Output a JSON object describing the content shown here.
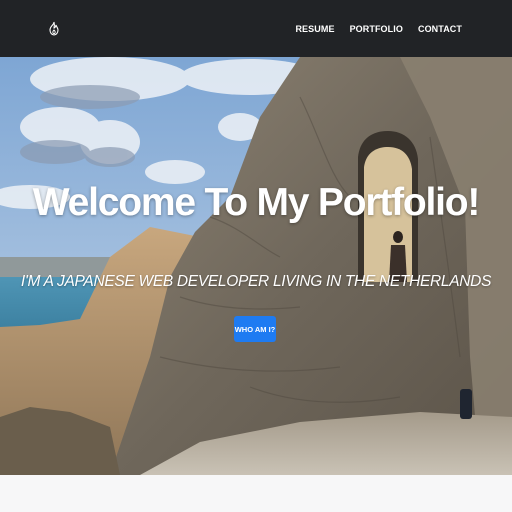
{
  "nav": {
    "logo_icon": "flame-icon",
    "links": [
      {
        "label": "RESUME"
      },
      {
        "label": "PORTFOLIO"
      },
      {
        "label": "CONTACT"
      }
    ],
    "background": "#212326"
  },
  "hero": {
    "title": "Welcome To My Portfolio!",
    "subtitle": "I'M A JAPANESE WEB DEVELOPER LIVING IN THE NETHERLANDS",
    "cta_label": "WHO AM I?",
    "cta_color": "#1e7bf2",
    "background_image": "rocky-coast-photo"
  }
}
